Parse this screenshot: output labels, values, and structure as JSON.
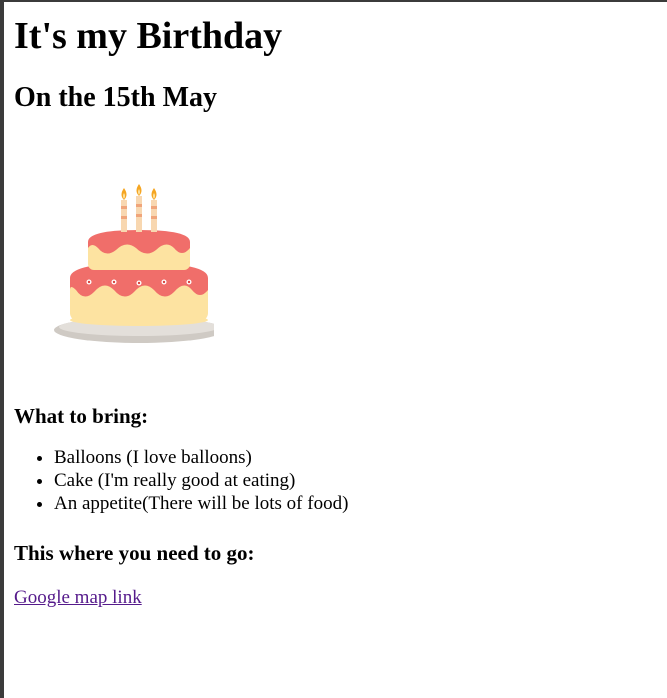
{
  "heading": "It's my Birthday",
  "subheading": "On the 15th May",
  "bring_title": "What to bring:",
  "bring_items": [
    "Balloons (I love balloons)",
    "Cake (I'm really good at eating)",
    "An appetite(There will be lots of food)"
  ],
  "go_title": "This where you need to go:",
  "map_link": "Google map link",
  "colors": {
    "frosting": "#f06e6a",
    "sponge": "#fde3a1",
    "plate": "#d9d5d0",
    "link": "#551a8b",
    "flame": "#f5a623"
  },
  "image": {
    "icon": "birthday-cake-icon"
  }
}
